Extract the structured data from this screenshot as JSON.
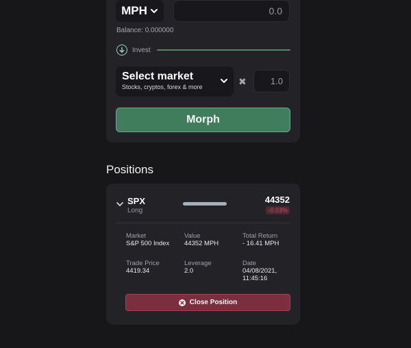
{
  "swap": {
    "currency": "MPH",
    "amount_value": "0.0",
    "balance": "Balance: 0.000000",
    "invest_label": "Invest",
    "market_title": "Select market",
    "market_subtitle": "Stocks, cryptos, forex & more",
    "multiplier_value": "1.0",
    "morph_label": "Morph"
  },
  "positions": {
    "title": "Positions",
    "items": [
      {
        "symbol": "SPX",
        "side": "Long",
        "value": "44352",
        "change": "-0.03%",
        "details": {
          "market_label": "Market",
          "market": "S&P 500 Index",
          "value_label": "Value",
          "value": "44352 MPH",
          "total_return_label": "Total Return",
          "total_return": "- 16.41 MPH",
          "trade_price_label": "Trade Price",
          "trade_price": "4419.34",
          "leverage_label": "Leverage",
          "leverage": "2.0",
          "date_label": "Date",
          "date_line1": "04/08/2021,",
          "date_line2": "11:45:16"
        },
        "close_label": "Close Position"
      }
    ]
  },
  "colors": {
    "background": "#17171a",
    "card": "#222227",
    "accent_green": "#3f7d5d",
    "danger": "#7a2e3e"
  }
}
